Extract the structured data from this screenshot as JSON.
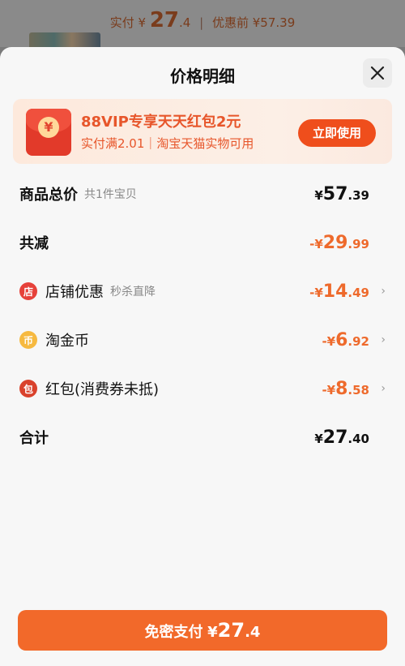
{
  "header_strip": {
    "paid_label": "实付",
    "paid_currency": "¥",
    "paid_int": "27",
    "paid_dec": ".4",
    "separator": "|",
    "before_label": "优惠前",
    "before_amount": "¥57.39"
  },
  "sheet": {
    "title": "价格明细",
    "close_icon": "close-icon"
  },
  "promo": {
    "icon_glyph": "¥",
    "title": "88VIP专享天天红包2元",
    "subtitle": "实付满2.01｜淘宝天猫实物可用",
    "button": "立即使用"
  },
  "rows": {
    "total": {
      "label": "商品总价",
      "sub": "共1件宝贝",
      "cur": "¥",
      "int": "57",
      "dec": ".39"
    },
    "reduce": {
      "label": "共减",
      "cur": "-¥",
      "int": "29",
      "dec": ".99"
    },
    "shop": {
      "label": "店铺优惠",
      "sub": "秒杀直降",
      "cur": "-¥",
      "int": "14",
      "dec": ".49",
      "icon_glyph": "店"
    },
    "coin": {
      "label": "淘金币",
      "cur": "-¥",
      "int": "6",
      "dec": ".92",
      "icon_glyph": "币"
    },
    "packet": {
      "label": "红包(消费券未抵)",
      "cur": "-¥",
      "int": "8",
      "dec": ".58",
      "icon_glyph": "包"
    },
    "sum": {
      "label": "合计",
      "cur": "¥",
      "int": "27",
      "dec": ".40"
    }
  },
  "pay_button": {
    "label": "免密支付",
    "cur": "¥",
    "int": "27",
    "dec": ".4"
  },
  "colors": {
    "accent": "#f2692a",
    "promo_text": "#e7562b",
    "negative_amount": "#ee6a2c"
  }
}
